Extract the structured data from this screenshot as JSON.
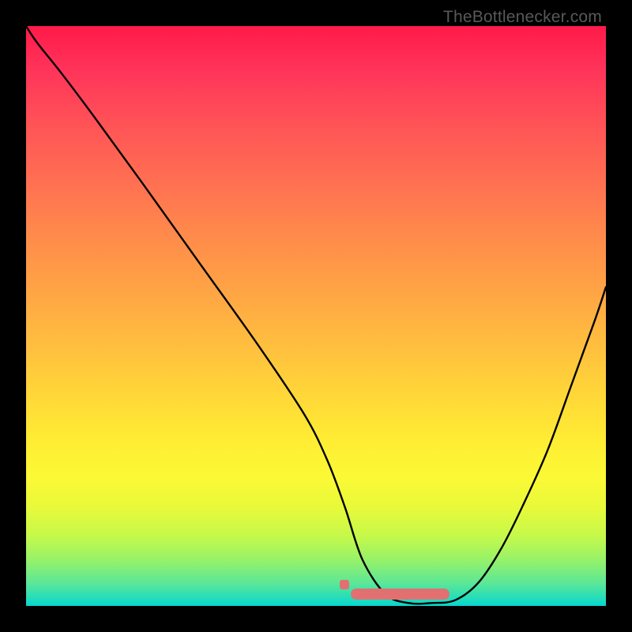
{
  "watermark": "TheBottlenecker.com",
  "chart_data": {
    "type": "line",
    "title": "",
    "xlabel": "",
    "ylabel": "",
    "xlim": [
      0,
      100
    ],
    "ylim": [
      0,
      100
    ],
    "grid": false,
    "background_gradient": {
      "stops": [
        {
          "pos": 0,
          "color": "#ff1a4a"
        },
        {
          "pos": 50,
          "color": "#ffc13e"
        },
        {
          "pos": 80,
          "color": "#fbf935"
        },
        {
          "pos": 100,
          "color": "#05d6d2"
        }
      ]
    },
    "series": [
      {
        "name": "bottleneck-curve",
        "color": "#000000",
        "x": [
          0,
          2,
          6,
          12,
          20,
          30,
          40,
          48,
          52,
          55,
          58,
          62,
          66,
          70,
          74,
          78,
          82,
          86,
          90,
          94,
          98,
          100
        ],
        "y": [
          100,
          97,
          92,
          84,
          73,
          59,
          45,
          33,
          25,
          17,
          8,
          2,
          0.5,
          0.5,
          1,
          4,
          10,
          18,
          27,
          38,
          49,
          55
        ]
      }
    ],
    "annotations": [
      {
        "name": "trough-highlight",
        "type": "bar-segment",
        "color": "#e27070",
        "x_start": 56,
        "x_end": 73,
        "y": 2
      }
    ]
  }
}
